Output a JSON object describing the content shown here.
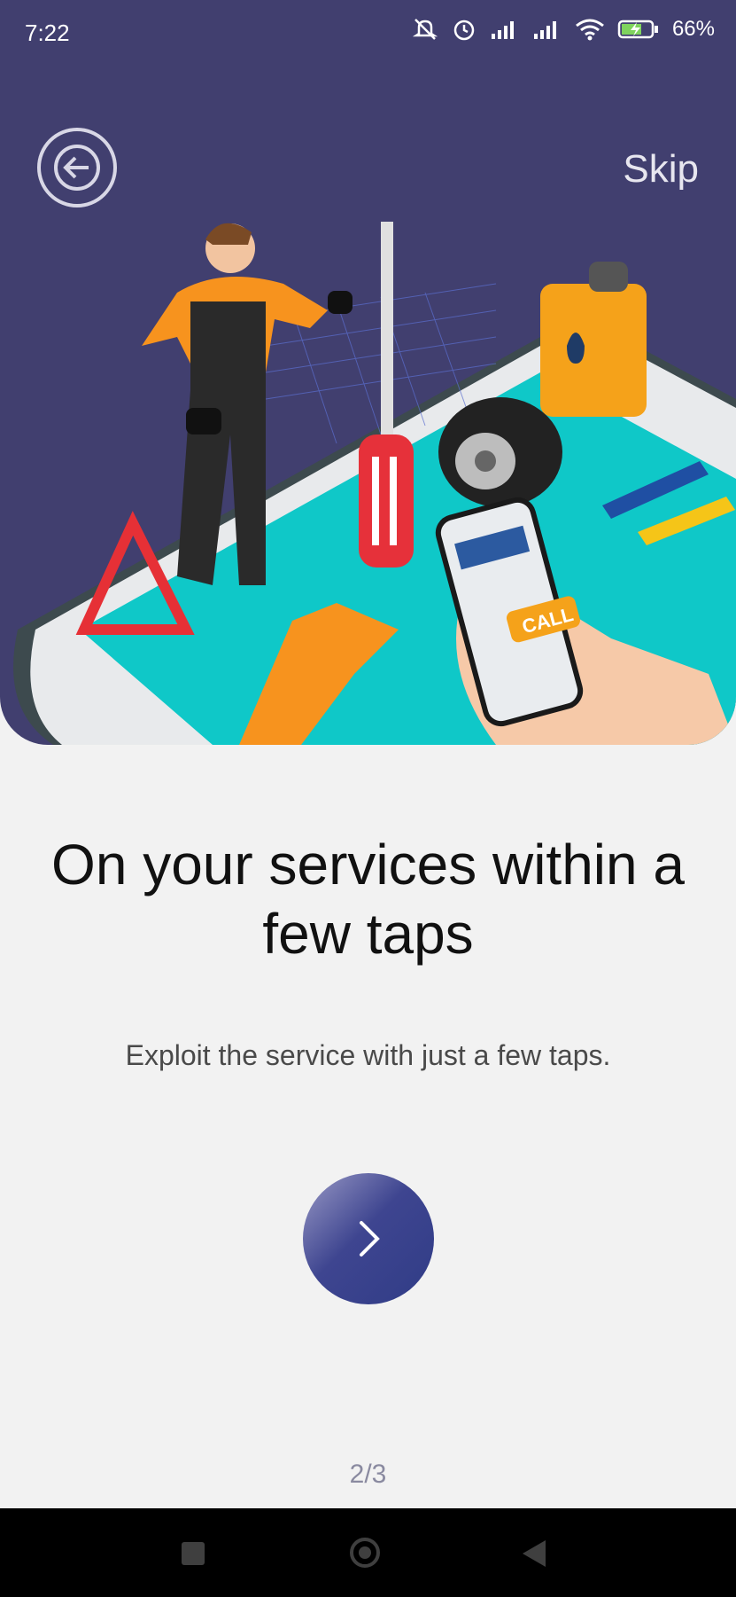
{
  "status_bar": {
    "time": "7:22",
    "battery_percent": "66%",
    "icons": [
      "notification-off-icon",
      "alarm-icon",
      "signal-icon",
      "signal-icon",
      "wifi-icon",
      "battery-charging-icon"
    ]
  },
  "header": {
    "back_icon": "arrow-left-icon",
    "skip_label": "Skip"
  },
  "colors": {
    "hero_background": "#413f6f",
    "page_background": "#f2f2f2",
    "button_primary": "#303c86",
    "turquoise": "#00bcbc",
    "orange": "#f7931e",
    "red": "#e63036"
  },
  "content": {
    "title": "On your services within a few taps",
    "subtitle": "Exploit the service with just a few taps.",
    "next_icon": "chevron-right-icon",
    "page_indicator": "2/3"
  },
  "illustration": {
    "call_label": "CALL"
  },
  "nav_bar": {
    "icons": [
      "recent-apps-icon",
      "home-icon",
      "back-icon"
    ]
  }
}
